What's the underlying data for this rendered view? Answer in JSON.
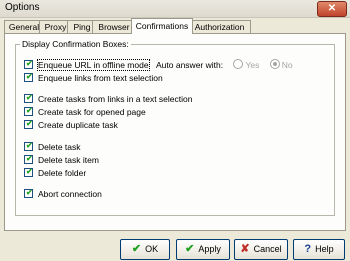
{
  "window": {
    "title": "Options",
    "close_label": "✕"
  },
  "tabs": [
    {
      "label": "General"
    },
    {
      "label": "Proxy"
    },
    {
      "label": "Ping"
    },
    {
      "label": "Browser"
    },
    {
      "label": "Confirmations"
    },
    {
      "label": "Authorization"
    }
  ],
  "group": {
    "legend": "Display Confirmation Boxes:",
    "items": [
      {
        "label": "Enqueue URL in offline mode",
        "checked": true
      },
      {
        "label": "Enqueue links from text selection",
        "checked": true
      },
      {
        "label": "Create tasks from links in a text selection",
        "checked": true
      },
      {
        "label": "Create task for opened page",
        "checked": true
      },
      {
        "label": "Create duplicate task",
        "checked": true
      },
      {
        "label": "Delete task",
        "checked": true
      },
      {
        "label": "Delete task item",
        "checked": true
      },
      {
        "label": "Delete folder",
        "checked": true
      },
      {
        "label": "Abort connection",
        "checked": true
      }
    ]
  },
  "auto_answer": {
    "label": "Auto answer with:",
    "yes_label": "Yes",
    "no_label": "No",
    "selected": "No",
    "enabled": false
  },
  "buttons": {
    "ok_label": "OK",
    "apply_label": "Apply",
    "cancel_label": "Cancel",
    "help_label": "Help"
  },
  "colors": {
    "check": "#21a121",
    "cancel": "#c0302a",
    "help": "#1b3f8f"
  }
}
